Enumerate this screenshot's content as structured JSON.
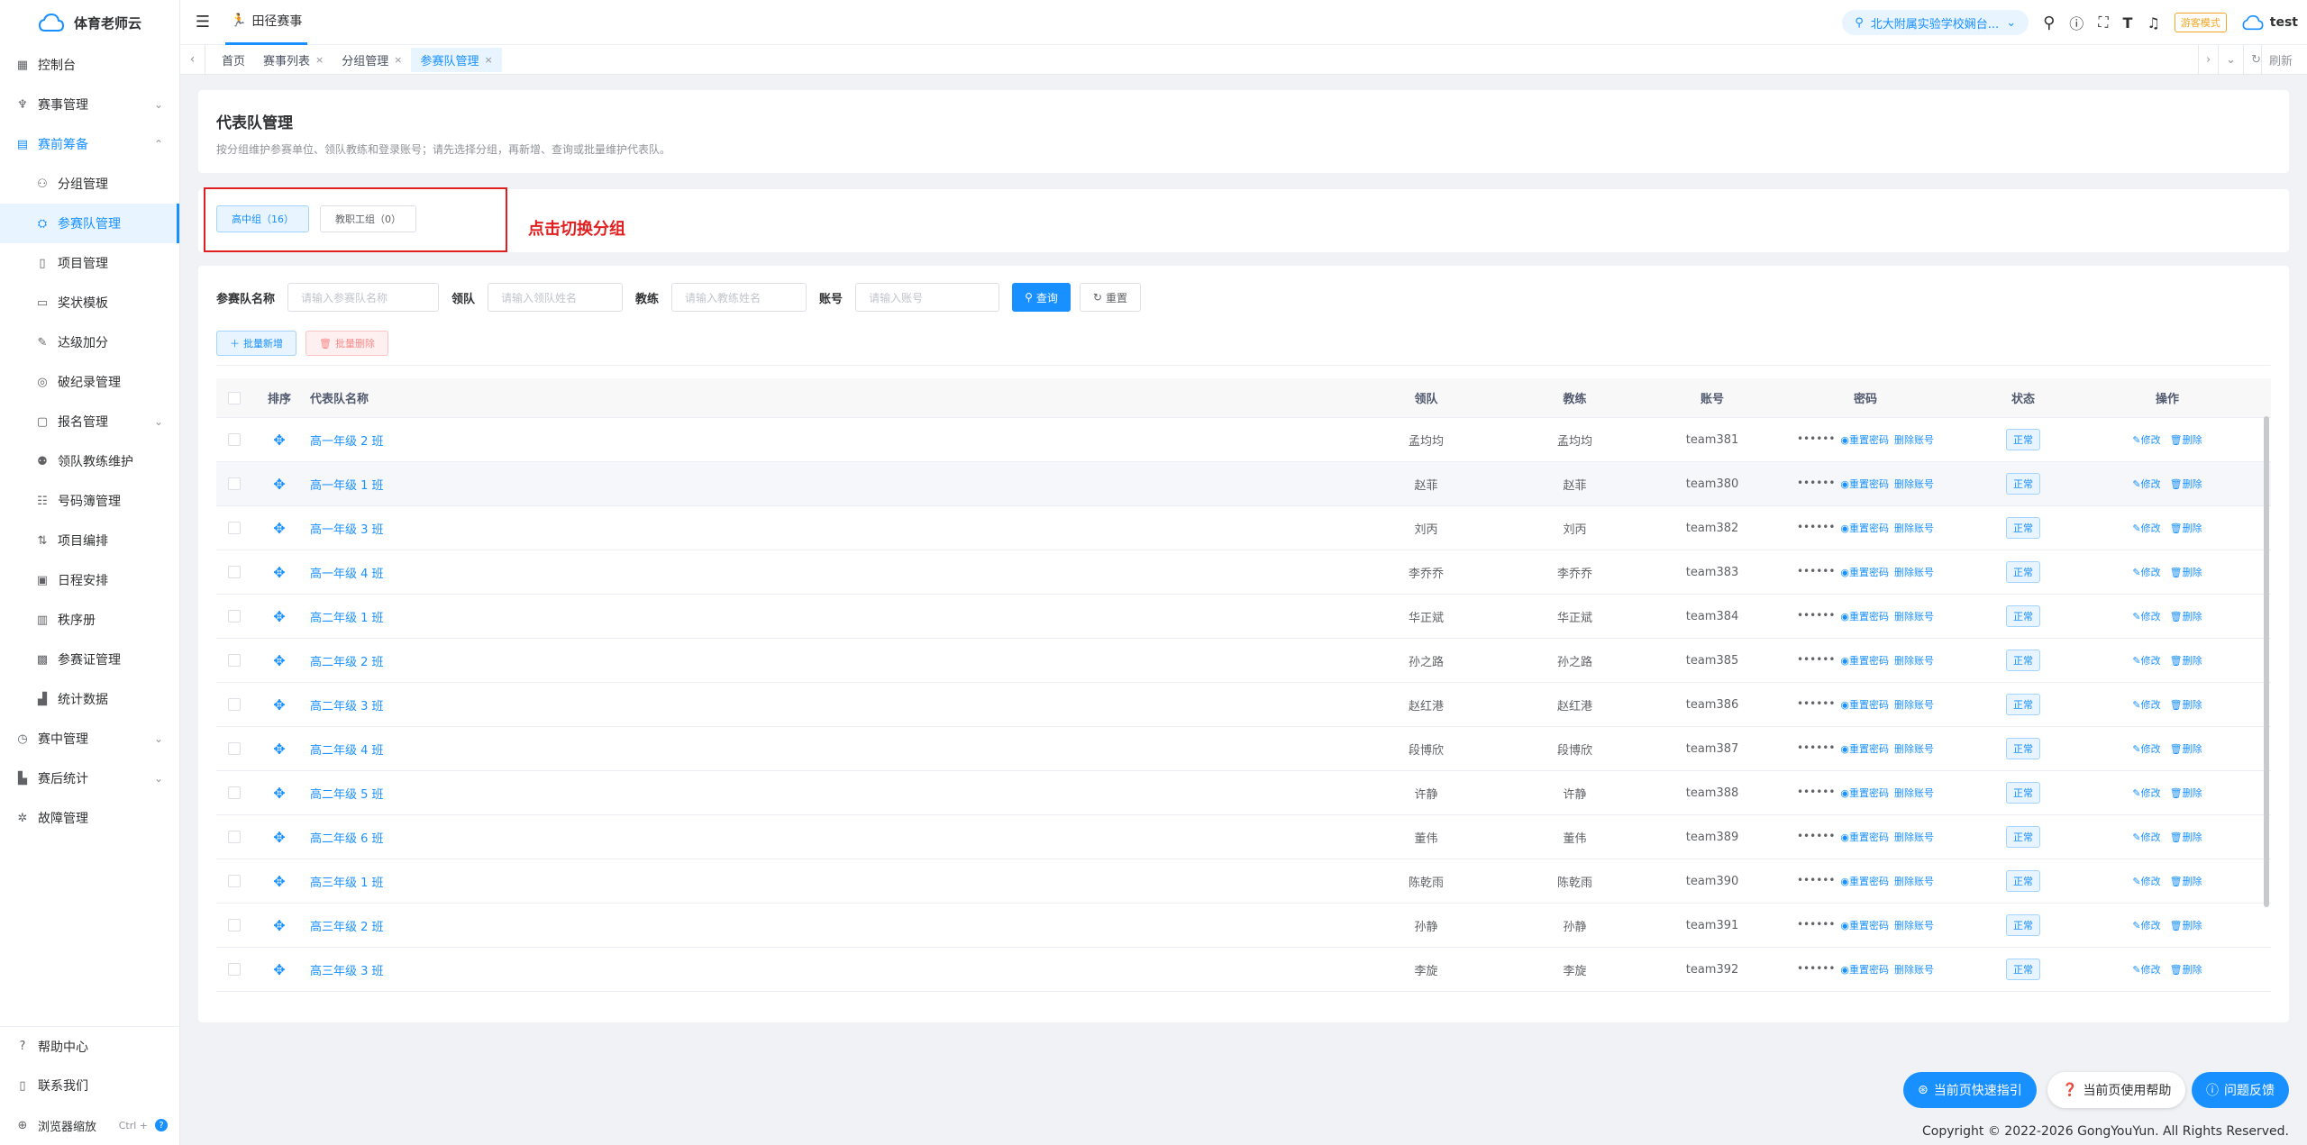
{
  "app": {
    "logo_text": "体育老师云"
  },
  "sidebar": {
    "items": [
      {
        "label": "控制台",
        "icon": "dashboard-icon"
      },
      {
        "label": "赛事管理",
        "icon": "trophy-icon"
      },
      {
        "label": "赛前筹备",
        "icon": "clipboard-icon"
      }
    ],
    "sub_items": [
      {
        "label": "分组管理"
      },
      {
        "label": "参赛队管理"
      },
      {
        "label": "项目管理"
      },
      {
        "label": "奖状模板"
      },
      {
        "label": "达级加分"
      },
      {
        "label": "破纪录管理"
      },
      {
        "label": "报名管理"
      },
      {
        "label": "领队教练维护"
      },
      {
        "label": "号码簿管理"
      },
      {
        "label": "项目编排"
      },
      {
        "label": "日程安排"
      },
      {
        "label": "秩序册"
      },
      {
        "label": "参赛证管理"
      },
      {
        "label": "统计数据"
      }
    ],
    "after_items": [
      {
        "label": "赛中管理"
      },
      {
        "label": "赛后统计"
      },
      {
        "label": "故障管理"
      }
    ],
    "bottom": {
      "help": "帮助中心",
      "contact": "联系我们",
      "zoom": "浏览器缩放",
      "zoom_shortcut": "Ctrl +"
    }
  },
  "topbar": {
    "tab_label": "田径赛事",
    "school": "北大附属实验学校娴台...",
    "guest_mode": "游客模式",
    "user": "test"
  },
  "tags": [
    {
      "label": "首页",
      "closable": false
    },
    {
      "label": "赛事列表",
      "closable": true
    },
    {
      "label": "分组管理",
      "closable": true
    },
    {
      "label": "参赛队管理",
      "closable": true
    }
  ],
  "refresh_label": "刷新",
  "page": {
    "title": "代表队管理",
    "description": "按分组维护参赛单位、领队教练和登录账号；请先选择分组，再新增、查询或批量维护代表队。"
  },
  "groups": [
    {
      "label": "高中组（16）"
    },
    {
      "label": "教职工组（0）"
    }
  ],
  "annotation": "点击切换分组",
  "filters": {
    "team_label": "参赛队名称",
    "team_placeholder": "请输入参赛队名称",
    "leader_label": "领队",
    "leader_placeholder": "请输入领队姓名",
    "coach_label": "教练",
    "coach_placeholder": "请输入教练姓名",
    "account_label": "账号",
    "account_placeholder": "请输入账号",
    "search": "查询",
    "reset": "重置"
  },
  "actions": {
    "batch_add": "批量新增",
    "batch_delete": "批量删除"
  },
  "table": {
    "headers": [
      "排序",
      "代表队名称",
      "领队",
      "教练",
      "账号",
      "密码",
      "状态",
      "操作"
    ],
    "pwd_mask": "••••••",
    "reset_pwd": "重置密码",
    "delete_acct": "删除账号",
    "edit": "修改",
    "delete": "删除",
    "rows": [
      {
        "name": "高一年级 2 班",
        "leader": "孟均均",
        "coach": "孟均均",
        "account": "team381",
        "status": "正常"
      },
      {
        "name": "高一年级 1 班",
        "leader": "赵菲",
        "coach": "赵菲",
        "account": "team380",
        "status": "正常"
      },
      {
        "name": "高一年级 3 班",
        "leader": "刘丙",
        "coach": "刘丙",
        "account": "team382",
        "status": "正常"
      },
      {
        "name": "高一年级 4 班",
        "leader": "李乔乔",
        "coach": "李乔乔",
        "account": "team383",
        "status": "正常"
      },
      {
        "name": "高二年级 1 班",
        "leader": "华正斌",
        "coach": "华正斌",
        "account": "team384",
        "status": "正常"
      },
      {
        "name": "高二年级 2 班",
        "leader": "孙之路",
        "coach": "孙之路",
        "account": "team385",
        "status": "正常"
      },
      {
        "name": "高二年级 3 班",
        "leader": "赵红港",
        "coach": "赵红港",
        "account": "team386",
        "status": "正常"
      },
      {
        "name": "高二年级 4 班",
        "leader": "段博欣",
        "coach": "段博欣",
        "account": "team387",
        "status": "正常"
      },
      {
        "name": "高二年级 5 班",
        "leader": "许静",
        "coach": "许静",
        "account": "team388",
        "status": "正常"
      },
      {
        "name": "高二年级 6 班",
        "leader": "董伟",
        "coach": "董伟",
        "account": "team389",
        "status": "正常"
      },
      {
        "name": "高三年级 1 班",
        "leader": "陈乾雨",
        "coach": "陈乾雨",
        "account": "team390",
        "status": "正常"
      },
      {
        "name": "高三年级 2 班",
        "leader": "孙静",
        "coach": "孙静",
        "account": "team391",
        "status": "正常"
      },
      {
        "name": "高三年级 3 班",
        "leader": "李旋",
        "coach": "李旋",
        "account": "team392",
        "status": "正常"
      }
    ]
  },
  "float_buttons": {
    "guide": "当前页快速指引",
    "help": "当前页使用帮助",
    "feedback": "问题反馈"
  },
  "footer": "Copyright © 2022-2026 GongYouYun. All Rights Reserved."
}
